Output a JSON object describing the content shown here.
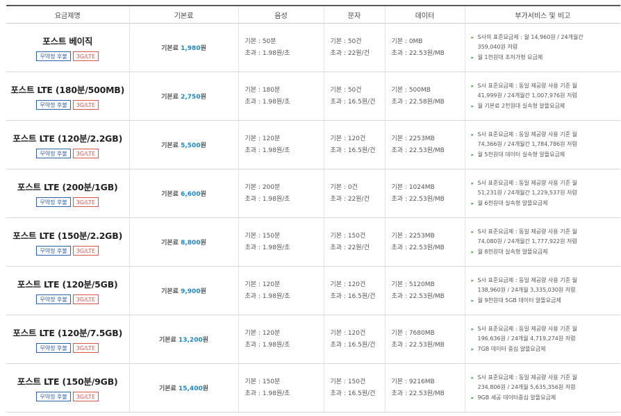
{
  "headers": [
    "요금제명",
    "기본료",
    "음성",
    "문자",
    "데이터",
    "부가서비스 및 비고"
  ],
  "tag_labels": {
    "contract": "무약정 후불",
    "network": "3G/LTE"
  },
  "fee_prefix": "기본료",
  "plans": [
    {
      "name": "포스트 베이직",
      "fee": "1,980",
      "fee_unit": "원",
      "voice": [
        "기본 : 50분",
        "초과 : 1.98원/초"
      ],
      "sms": [
        "기본 : 50건",
        "초과 : 22원/건"
      ],
      "data": [
        "기본 : 0MB",
        "초과 : 22.53원/MB"
      ],
      "notes": [
        "S사의 표준요금제 : 월 14,960원 / 24개월간",
        "359,040원 저렴",
        "월 1천원대 초저가형 요금제"
      ]
    },
    {
      "name": "포스트 LTE (180분/500MB)",
      "fee": "2,750",
      "fee_unit": "원",
      "voice": [
        "기본 : 180분",
        "초과 : 1.98원/초"
      ],
      "sms": [
        "기본 : 50건",
        "초과 : 16.5원/건"
      ],
      "data": [
        "기본 : 500MB",
        "초과 : 22.58원/MB"
      ],
      "notes": [
        "S사 표준요금제 : 동일 제공량 사용 기준 월",
        "41,999원 / 24개월간 1,007,976원 저렴",
        "월 기본료 2천원대 실속형 알뜰요금제"
      ]
    },
    {
      "name": "포스트 LTE (120분/2.2GB)",
      "fee": "5,500",
      "fee_unit": "원",
      "voice": [
        "기본 : 120분",
        "초과 : 1.98원/초"
      ],
      "sms": [
        "기본 : 120건",
        "초과 : 16.5원/건"
      ],
      "data": [
        "기본 : 2253MB",
        "초과 : 22.53원/MB"
      ],
      "notes": [
        "S사 표준요금제 : 동일 제공량 사용 기준 월",
        "74,366원 / 24개월간 1,784,786원 저렴",
        "월 5천원대 데이터 실속형 알뜰요금제"
      ]
    },
    {
      "name": "포스트 LTE (200분/1GB)",
      "fee": "6,600",
      "fee_unit": "원",
      "voice": [
        "기본 : 200분",
        "초과 : 1.98원/초"
      ],
      "sms": [
        "기본 : 0건",
        "초과 : 22원/건"
      ],
      "data": [
        "기본 : 1024MB",
        "초과 : 22.53원/MB"
      ],
      "notes": [
        "S사 표준요금제 : 동일 제공량 사용 기준 월",
        "51,231원 / 24개월간 1,229,537원 저렴",
        "월 6천원대 실속형 알뜰요금제"
      ]
    },
    {
      "name": "포스트 LTE (150분/2.2GB)",
      "fee": "8,800",
      "fee_unit": "원",
      "voice": [
        "기본 : 150분",
        "초과 : 1.98원/초"
      ],
      "sms": [
        "기본 : 150건",
        "초과 : 22원/건"
      ],
      "data": [
        "기본 : 2253MB",
        "초과 : 22.53원/MB"
      ],
      "notes": [
        "S사 표준요금제 : 동일 제공량 사용 기준 월",
        "74,080원 / 24개월간 1,777,922원 저렴",
        "월 8천원대 실속형 알뜰요금제"
      ]
    },
    {
      "name": "포스트 LTE (120분/5GB)",
      "fee": "9,900",
      "fee_unit": "원",
      "voice": [
        "기본 : 120분",
        "초과 : 1.98원/초"
      ],
      "sms": [
        "기본 : 120건",
        "초과 : 16.5원/건"
      ],
      "data": [
        "기본 : 5120MB",
        "초과 : 22.53원/MB"
      ],
      "notes": [
        "S사 표준요금제 : 동일 제공량 사용 기준 월",
        "138,960원 / 24개월 3,335,030원 저렴",
        "월 9천원대 5GB 데이터 알뜰요금제"
      ]
    },
    {
      "name": "포스트 LTE (120분/7.5GB)",
      "fee": "13,200",
      "fee_unit": "원",
      "voice": [
        "기본 : 120분",
        "초과 : 1.98원/초"
      ],
      "sms": [
        "기본 : 120건",
        "초과 : 16.5원/건"
      ],
      "data": [
        "기본 : 7680MB",
        "초과 : 22.53원/MB"
      ],
      "notes": [
        "S사 표준요금제 : 동일 제공량 사용 기준 월",
        "196,636원 / 24개월 4,719,274원 저렴",
        "7GB 데이터 중심 알뜰요금제"
      ]
    },
    {
      "name": "포스트 LTE (150분/9GB)",
      "fee": "15,400",
      "fee_unit": "원",
      "voice": [
        "기본 : 150분",
        "초과 : 1.98원/초"
      ],
      "sms": [
        "기본 : 150건",
        "초과 : 16.5원/건"
      ],
      "data": [
        "기본 : 9216MB",
        "초과 : 22.53원/MB"
      ],
      "notes": [
        "S사 표준요금제 : 동일 제공량 사용 기준 월",
        "234,806원 / 24개월 5,635,356원 저렴",
        "9GB 세공 데이터중심 알뜰요금제"
      ]
    }
  ],
  "colors": {
    "fee_accent": "#1f87c6",
    "tag_blue": "#2b5fa8",
    "tag_red": "#d9534f",
    "bullet": "#4aa34a"
  },
  "icons": {
    "note_bullet": "triangle-bullet-icon"
  }
}
